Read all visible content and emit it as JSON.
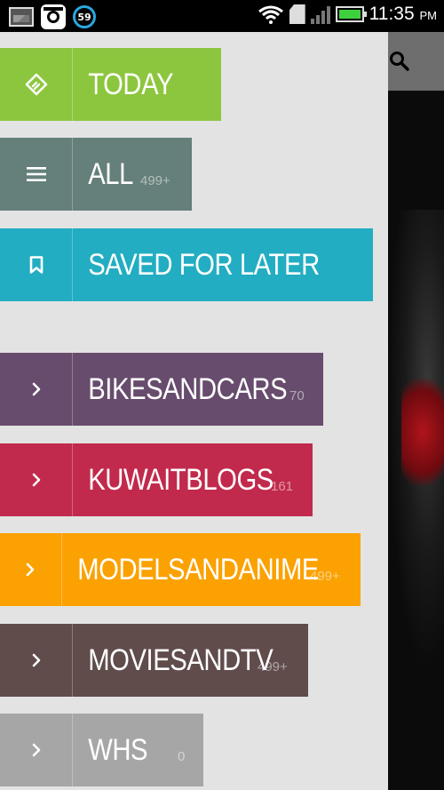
{
  "status_bar": {
    "notification_badge": "59",
    "time": "11:35",
    "ampm": "PM"
  },
  "drawer": {
    "items": [
      {
        "label": "TODAY",
        "count": "",
        "color": "#8cc63e",
        "icon": "feedly-icon"
      },
      {
        "label": "ALL",
        "count": "499+",
        "color": "#657f7a",
        "icon": "list-icon"
      },
      {
        "label": "SAVED FOR LATER",
        "count": "",
        "color": "#22adc2",
        "icon": "bookmark-icon"
      },
      {
        "label": "BIKESANDCARS",
        "count": "70",
        "color": "#674c6d",
        "icon": "chevron-right-icon"
      },
      {
        "label": "KUWAITBLOGS",
        "count": "161",
        "color": "#c12a4c",
        "icon": "chevron-right-icon"
      },
      {
        "label": "MODELSANDANIME",
        "count": "499+",
        "color": "#fba101",
        "icon": "chevron-right-icon"
      },
      {
        "label": "MOVIESANDTV",
        "count": "499+",
        "color": "#5f4c4b",
        "icon": "chevron-right-icon"
      },
      {
        "label": "WHS",
        "count": "0",
        "color": "#a6a6a6",
        "icon": "chevron-right-icon"
      }
    ]
  },
  "background_app": {
    "toolbar_color": "#6e6e6e",
    "search_icon": "search-icon"
  }
}
